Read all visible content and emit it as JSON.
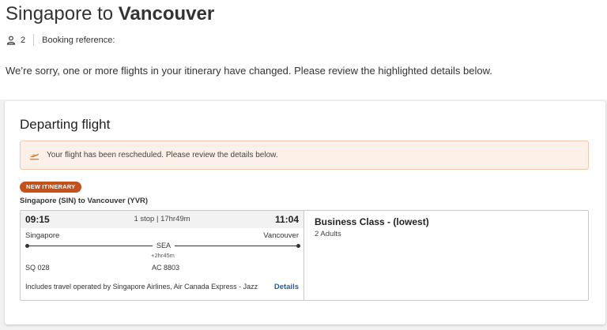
{
  "header": {
    "title_plain": "Singapore to",
    "title_bold": "Vancouver",
    "passenger_count": "2",
    "booking_reference_label": "Booking reference:",
    "notice": "We’re sorry, one or more flights in your itinerary have changed. Please review the highlighted details below."
  },
  "departing": {
    "title": "Departing flight",
    "alert_text": "Your flight has been rescheduled. Please review the details below.",
    "badge": "NEW ITINERARY",
    "route": "Singapore (SIN) to Vancouver (YVR)",
    "segment": {
      "dep_time": "09:15",
      "stops": "1 stop | 17hr49m",
      "arr_time": "11:04",
      "origin": "Singapore",
      "destination": "Vancouver",
      "via": "SEA",
      "layover": "+2hr45m",
      "flight_1": "SQ 028",
      "flight_2": "AC 8803",
      "operated_by": "Includes travel operated by Singapore Airlines, Air Canada Express - Jazz",
      "details_link": "Details"
    },
    "fare": {
      "cabin": "Business Class - (lowest)",
      "passengers": "2 Adults"
    }
  },
  "colors": {
    "badge": "#c4511c",
    "alert_bg": "#fdf0e8",
    "alert_icon": "#e07020",
    "link": "#2a5d9f"
  },
  "icons": {
    "passenger": "person-icon",
    "alert": "plane-departure-icon"
  }
}
